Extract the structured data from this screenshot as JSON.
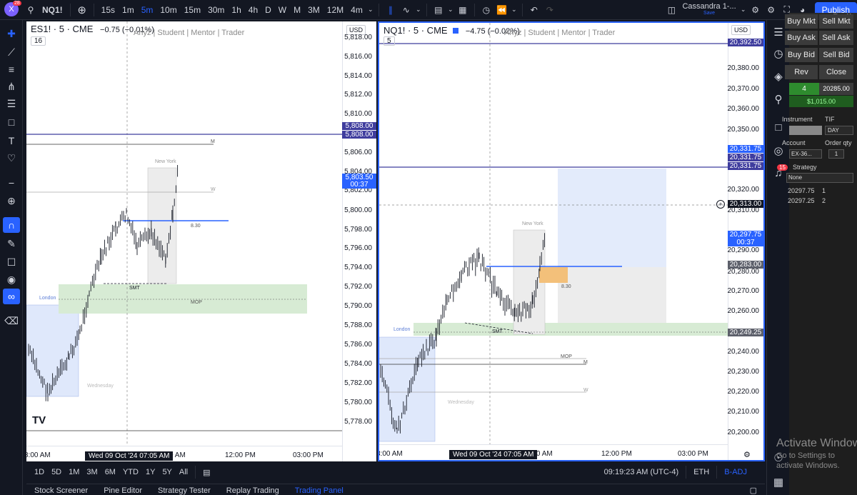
{
  "topbar": {
    "symbol": "NQ1!",
    "notif_count": "28",
    "intervals": [
      "15s",
      "1m",
      "5m",
      "10m",
      "15m",
      "30m",
      "1h",
      "4h",
      "D",
      "W",
      "M",
      "3M",
      "12M",
      "4m"
    ],
    "active_interval": "5m",
    "layout_name": "Cassandra 1-...",
    "layout_sub": "Save",
    "publish_label": "Publish"
  },
  "pane1": {
    "symbol": "ES1! · 5 · CME",
    "change": "−0.75 (−0.01%)",
    "watermark": "Ariyz | Student | Mentor | Trader",
    "badge": "16",
    "currency": "USD",
    "yticks": [
      "5,818.00",
      "5,816.00",
      "5,814.00",
      "5,812.00",
      "5,810.00",
      "5,806.00",
      "5,804.00",
      "5,802.00",
      "5,800.00",
      "5,798.00",
      "5,796.00",
      "5,794.00",
      "5,792.00",
      "5,790.00",
      "5,788.00",
      "5,786.00",
      "5,784.00",
      "5,782.00",
      "5,780.00",
      "5,778.00"
    ],
    "price_labels": [
      "5,808.00",
      "5,808.00",
      "5,803.50",
      "00:37"
    ],
    "xticks": [
      "8:00 AM",
      "0 AM",
      "12:00 PM",
      "03:00 PM"
    ],
    "x_cursor": "Wed 09 Oct '24   07:05 AM",
    "annotations": {
      "m": "M",
      "w": "W",
      "smt": "SMT",
      "mop": "MOP",
      "london": "London",
      "newyork": "New York",
      "weds": "Wednesday",
      "v830": "8.30"
    }
  },
  "pane2": {
    "symbol": "NQ1! · 5 · CME",
    "change": "−4.75 (−0.02%)",
    "watermark": "Ariyz | Student | Mentor | Trader",
    "badge": "5",
    "currency": "USD",
    "yticks": [
      "20,380.00",
      "20,370.00",
      "20,360.00",
      "20,350.00",
      "20,320.00",
      "20,310.00",
      "20,290.00",
      "20,280.00",
      "20,270.00",
      "20,260.00",
      "20,240.00",
      "20,230.00",
      "20,220.00",
      "20,210.00",
      "20,200.00"
    ],
    "price_labels": [
      "20,392.50",
      "20,331.75",
      "20,331.75",
      "20,331.75",
      "20,313.00",
      "20,297.75",
      "00:37",
      "20,283.00",
      "20,249.25"
    ],
    "xticks": [
      "8:00 AM",
      "0:00 AM",
      "12:00 PM",
      "03:00 PM"
    ],
    "x_cursor": "Wed 09 Oct '24   07:05 AM",
    "annotations": {
      "m": "M",
      "w": "W",
      "smt": "SMT",
      "mop": "MOP",
      "london": "London",
      "newyork": "New York",
      "weds": "Wednesday",
      "v830": "8.30"
    }
  },
  "timebar": {
    "ranges": [
      "1D",
      "5D",
      "1M",
      "3M",
      "6M",
      "YTD",
      "1Y",
      "5Y",
      "All"
    ],
    "clock": "09:19:23 AM (UTC-4)",
    "session": "ETH",
    "adj": "B-ADJ"
  },
  "bottomtabs": [
    "Stock Screener",
    "Pine Editor",
    "Strategy Tester",
    "Replay Trading",
    "Trading Panel"
  ],
  "active_tab": "Trading Panel",
  "rightstrip": {
    "alert_count": "15"
  },
  "trade": {
    "buy_mkt": "Buy Mkt",
    "sell_mkt": "Sell Mkt",
    "buy_ask": "Buy Ask",
    "sell_ask": "Sell Ask",
    "buy_bid": "Buy Bid",
    "sell_bid": "Sell Bid",
    "rev": "Rev",
    "close": "Close",
    "qty": "4",
    "price": "20285.00",
    "pnl": "$1,015.00",
    "instrument_label": "Instrument",
    "tif_label": "TIF",
    "tif_value": "DAY",
    "account_label": "Account",
    "order_qty_label": "Order qty",
    "account_value": "EX-36...",
    "order_qty_value": "1",
    "strategy_label": "Strategy",
    "strategy_value": "None",
    "rows": [
      [
        "20297.75",
        "1"
      ],
      [
        "20297.25",
        "2"
      ]
    ]
  },
  "windows_mark": {
    "line1": "Activate Windows",
    "line2": "Go to Settings to",
    "line3": "activate Windows."
  },
  "colors": {
    "accent": "#2962ff",
    "purple_line": "#3f3d9e",
    "zone_green": "#cfe8cf",
    "zone_blue": "#dfe8fb",
    "orange": "#f3c07a"
  }
}
